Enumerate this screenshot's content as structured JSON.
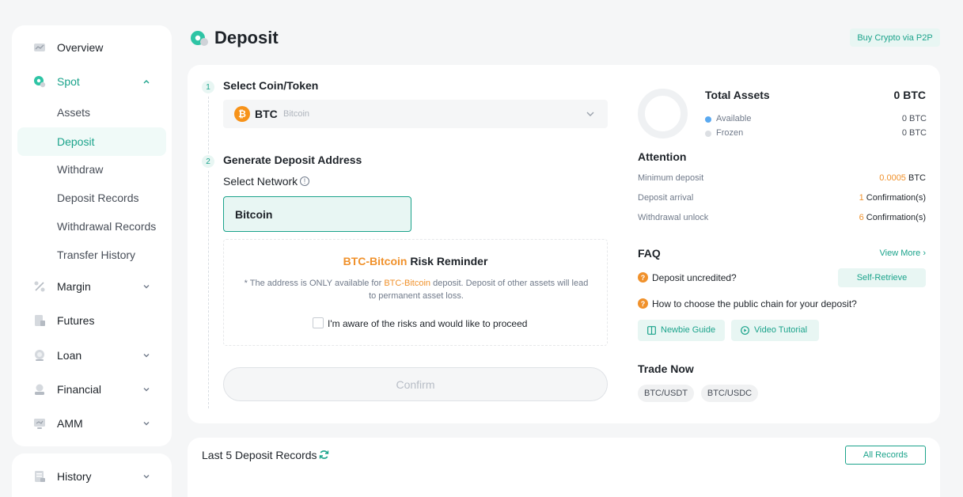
{
  "sidebar": {
    "items": [
      {
        "label": "Overview",
        "icon": "chart-icon"
      },
      {
        "label": "Spot",
        "icon": "spot-icon"
      },
      {
        "label": "Margin",
        "icon": "percent-icon"
      },
      {
        "label": "Futures",
        "icon": "futures-icon"
      },
      {
        "label": "Loan",
        "icon": "loan-icon"
      },
      {
        "label": "Financial",
        "icon": "financial-icon"
      },
      {
        "label": "AMM",
        "icon": "amm-icon"
      }
    ],
    "spot_sub": [
      "Assets",
      "Deposit",
      "Withdraw",
      "Deposit Records",
      "Withdrawal Records",
      "Transfer History"
    ],
    "history": {
      "label": "History",
      "icon": "history-icon"
    }
  },
  "header": {
    "title": "Deposit",
    "p2p_label": "Buy Crypto via P2P"
  },
  "steps": {
    "step1": {
      "num": "1",
      "title": "Select Coin/Token"
    },
    "step2": {
      "num": "2",
      "title": "Generate Deposit Address"
    }
  },
  "coin": {
    "symbol": "BTC",
    "name": "Bitcoin",
    "glyph": "₿"
  },
  "network": {
    "label": "Select Network",
    "info": "!",
    "selected": "Bitcoin"
  },
  "risk": {
    "title_highlight": "BTC-Bitcoin",
    "title_rest": " Risk Reminder",
    "text_pre": "* The address is ONLY available for ",
    "text_highlight": "BTC-Bitcoin",
    "text_post": " deposit. Deposit of other assets will lead to permanent asset loss.",
    "checkbox_label": "I'm aware of the risks and would like to proceed"
  },
  "confirm_label": "Confirm",
  "assets": {
    "title": "Total Assets",
    "total": "0 BTC",
    "legend": [
      {
        "name": "Available",
        "value": "0 BTC",
        "color": "#5aa9f0"
      },
      {
        "name": "Frozen",
        "value": "0 BTC",
        "color": "#dcdfe3"
      }
    ]
  },
  "attention": {
    "title": "Attention",
    "rows": [
      {
        "label": "Minimum deposit",
        "value_highlight": "0.0005",
        "value_rest": " BTC"
      },
      {
        "label": "Deposit arrival",
        "value_highlight": "1",
        "value_rest": " Confirmation(s)"
      },
      {
        "label": "Withdrawal unlock",
        "value_highlight": "6",
        "value_rest": " Confirmation(s)"
      }
    ]
  },
  "faq": {
    "title": "FAQ",
    "view_more": "View More",
    "q1": "Deposit uncredited?",
    "self_retrieve": "Self-Retrieve",
    "q2": "How to choose the public chain for your deposit?",
    "newbie": "Newbie Guide",
    "video": "Video Tutorial"
  },
  "trade": {
    "title": "Trade Now",
    "pairs": [
      "BTC/USDT",
      "BTC/USDC"
    ]
  },
  "records": {
    "title": "Last 5 Deposit Records",
    "all_label": "All Records"
  },
  "colors": {
    "accent": "#1ba38b",
    "warning": "#f0912b",
    "btc": "#f7931a"
  }
}
